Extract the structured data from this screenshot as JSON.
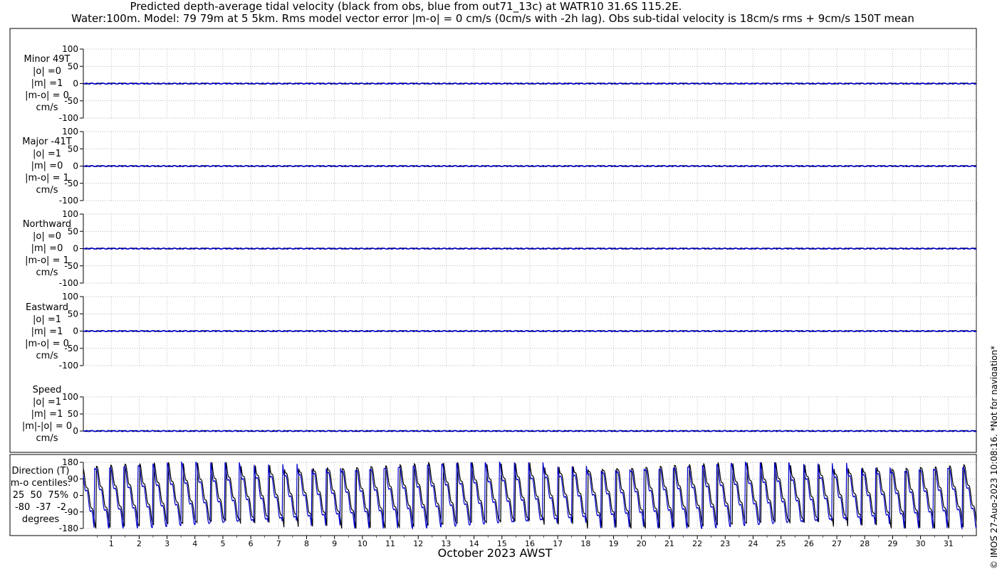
{
  "title_line1": "Predicted depth-average tidal velocity (black from obs, blue from out71_13c) at WATR10 31.6S 115.2E.",
  "title_line2": "Water:100m. Model: 79 79m at 5 5km. Rms model vector error |m-o| = 0 cm/s (0cm/s with -2h lag). Obs sub-tidal velocity is 18cm/s rms + 9cm/s 150T mean",
  "xlabel": "October 2023 AWST",
  "copyright": "© IMOS 27-Aug-2023 10:08:16. *Not for navigation*",
  "colors": {
    "obs": "#000000",
    "model": "#0000cc",
    "grid": "#9a9a9a"
  },
  "panels": [
    {
      "label": "Minor 49T\n|o| =0\n|m| =1\n|m-o| = 0\ncm/s"
    },
    {
      "label": "Major -41T\n|o| =1\n|m| =0\n|m-o| = 1\ncm/s"
    },
    {
      "label": "Northward\n|o| =0\n|m| =0\n|m-o| = 1\ncm/s"
    },
    {
      "label": "Eastward\n|o| =1\n|m| =1\n|m-o| = 0\ncm/s"
    },
    {
      "label": "Speed\n|o| =1\n|m| =1\n|m|-|o| = 0\ncm/s"
    }
  ],
  "direction_label": "Direction (T)\nm-o centiles:\n25  50  75%\n-80  -37  -2\ndegrees",
  "chart_data": [
    {
      "type": "line",
      "title": "Minor 49T",
      "xlabel": "October 2023 AWST",
      "xlim": [
        0,
        32
      ],
      "ylim": [
        -100,
        100
      ],
      "yticks": [
        -100,
        -50,
        0,
        50,
        100
      ],
      "xticks": [
        1,
        2,
        3,
        4,
        5,
        6,
        7,
        8,
        9,
        10,
        11,
        12,
        13,
        14,
        15,
        16,
        17,
        18,
        19,
        20,
        21,
        22,
        23,
        24,
        25,
        26,
        27,
        28,
        29,
        30,
        31
      ],
      "series": [
        {
          "name": "obs",
          "rms": 0
        },
        {
          "name": "model",
          "rms": 1
        }
      ]
    },
    {
      "type": "line",
      "title": "Major -41T",
      "ylim": [
        -100,
        100
      ],
      "yticks": [
        -100,
        -50,
        0,
        50,
        100
      ],
      "series": [
        {
          "name": "obs",
          "rms": 1
        },
        {
          "name": "model",
          "rms": 0
        }
      ]
    },
    {
      "type": "line",
      "title": "Northward",
      "ylim": [
        -100,
        100
      ],
      "yticks": [
        -100,
        -50,
        0,
        50,
        100
      ],
      "series": [
        {
          "name": "obs",
          "rms": 0
        },
        {
          "name": "model",
          "rms": 0
        }
      ]
    },
    {
      "type": "line",
      "title": "Eastward",
      "ylim": [
        -100,
        100
      ],
      "yticks": [
        -100,
        -50,
        0,
        50,
        100
      ],
      "series": [
        {
          "name": "obs",
          "rms": 1
        },
        {
          "name": "model",
          "rms": 1
        }
      ]
    },
    {
      "type": "line",
      "title": "Speed",
      "ylim": [
        0,
        100
      ],
      "yticks": [
        0,
        50,
        100
      ],
      "series": [
        {
          "name": "obs",
          "rms": 1
        },
        {
          "name": "model",
          "rms": 1
        }
      ]
    },
    {
      "type": "line",
      "title": "Direction (T)",
      "ylim": [
        -180,
        180
      ],
      "yticks": [
        -180,
        -90,
        0,
        90,
        180
      ],
      "centiles": {
        "p25": -80,
        "p50": -37,
        "p75": -2
      },
      "series": [
        {
          "name": "obs"
        },
        {
          "name": "model"
        }
      ]
    }
  ]
}
